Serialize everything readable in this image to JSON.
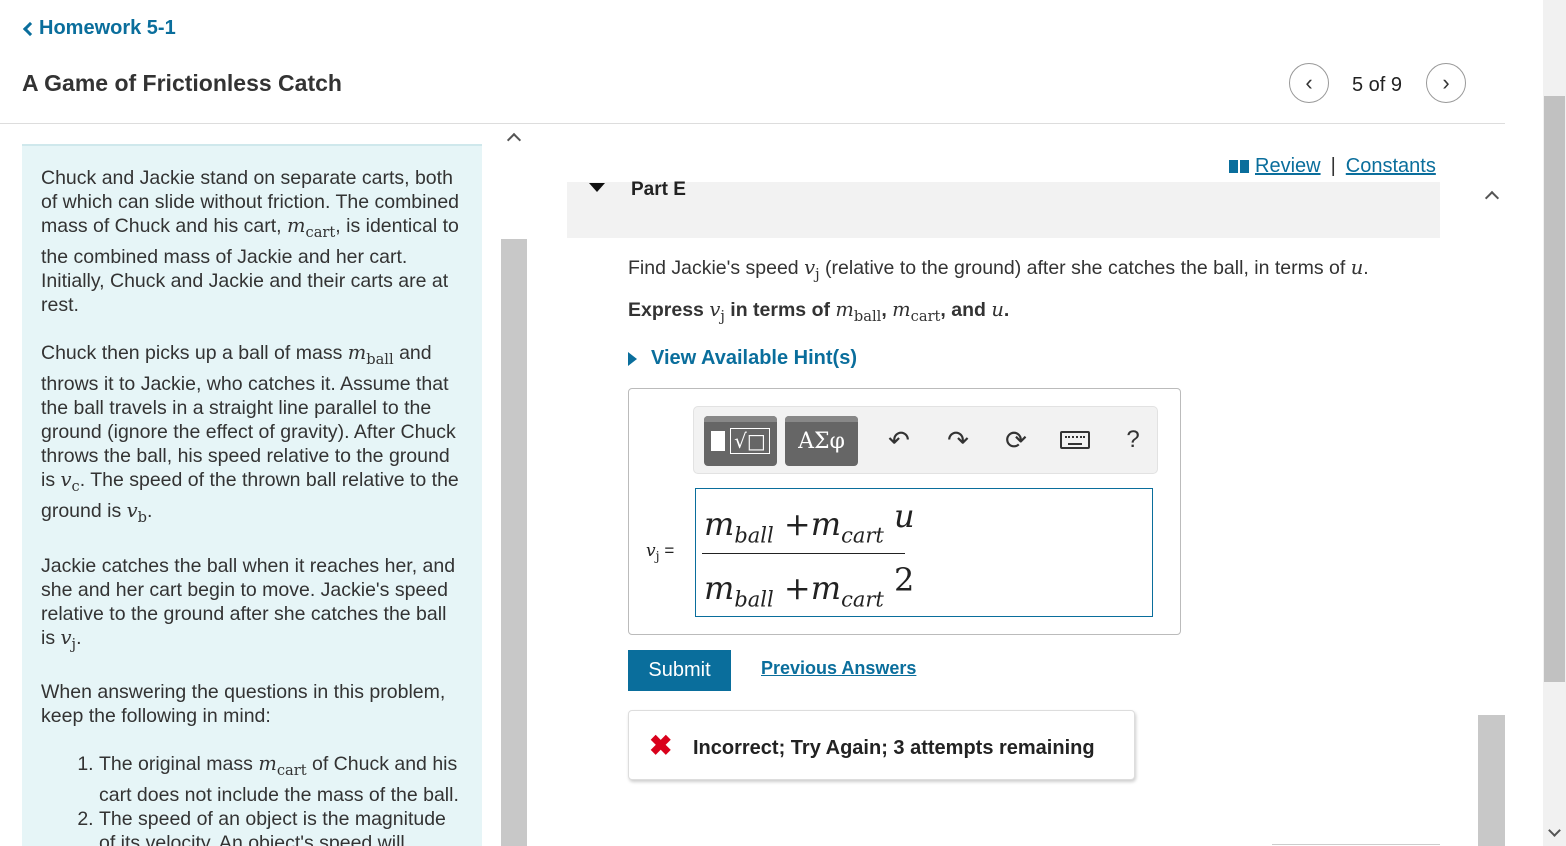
{
  "header": {
    "back_label": "Homework 5-1",
    "title": "A Game of Frictionless Catch",
    "pager_text": "5 of 9"
  },
  "intro": {
    "p1_a": "Chuck and Jackie stand on separate carts, both of which can slide without friction. The combined mass of Chuck and his cart, ",
    "p1_var": "m",
    "p1_sub": "cart",
    "p1_b": ", is identical to the combined mass of Jackie and her cart. Initially, Chuck and Jackie and their carts are at rest.",
    "p2_a": "Chuck then picks up a ball of mass ",
    "p2_var": "m",
    "p2_sub": "ball",
    "p2_b": " and throws it to Jackie, who catches it. Assume that the ball travels in a straight line parallel to the ground (ignore the effect of gravity). After Chuck throws the ball, his speed relative to the ground is ",
    "p2_vc": "v",
    "p2_vc_sub": "c",
    "p2_c": ". The speed of the thrown ball relative to the ground is ",
    "p2_vb": "v",
    "p2_vb_sub": "b",
    "p2_d": ".",
    "p3_a": "Jackie catches the ball when it reaches her, and she and her cart begin to move. Jackie's speed relative to the ground after she catches the ball is ",
    "p3_var": "v",
    "p3_sub": "j",
    "p3_b": ".",
    "p4": "When answering the questions in this problem, keep the following in mind:",
    "li1_a": "The original mass ",
    "li1_var": "m",
    "li1_sub": "cart",
    "li1_b": " of Chuck and his cart does not include the mass of the ball.",
    "li2": "The speed of an object is the magnitude of its velocity. An object's speed will always be a"
  },
  "review": {
    "review_label": "Review",
    "separator": "|",
    "constants_label": "Constants"
  },
  "part": {
    "label": "Part E",
    "question_a": "Find Jackie's speed ",
    "question_var": "v",
    "question_sub": "j",
    "question_b": " (relative to the ground) after she catches the ball, in terms of ",
    "question_u": "u",
    "question_c": ".",
    "express_a": "Express ",
    "express_var": "v",
    "express_sub": "j",
    "express_b": " in terms of ",
    "express_m1": "m",
    "express_m1_sub": "ball",
    "express_comma1": ", ",
    "express_m2": "m",
    "express_m2_sub": "cart",
    "express_c": ", and ",
    "express_u": "u",
    "express_d": "."
  },
  "hint": {
    "label": "View Available Hint(s)"
  },
  "toolbar": {
    "symbols_label": "ΑΣφ",
    "templates_root": "√□",
    "undo_icon": "undo-icon",
    "redo_icon": "redo-icon",
    "reset_icon": "reset-icon",
    "keyboard_icon": "keyboard-icon",
    "help_label": "?"
  },
  "answer": {
    "var": "v",
    "var_sub": "j",
    "equals": "=",
    "numer_m1": "m",
    "numer_m1_sub": "ball",
    "numer_plus": "+",
    "numer_m2": "m",
    "numer_m2_sub": "cart",
    "numer_u": "u",
    "denom_m1": "m",
    "denom_m1_sub": "ball",
    "denom_plus": "+",
    "denom_m2": "m",
    "denom_m2_sub": "cart",
    "denom_2": "2"
  },
  "actions": {
    "submit_label": "Submit",
    "previous_answers_label": "Previous Answers"
  },
  "feedback": {
    "icon": "✖",
    "text": "Incorrect; Try Again; 3 attempts remaining"
  },
  "colors": {
    "accent": "#0a6e9c",
    "intro_bg": "#e6f5f7",
    "error": "#d9001b"
  }
}
